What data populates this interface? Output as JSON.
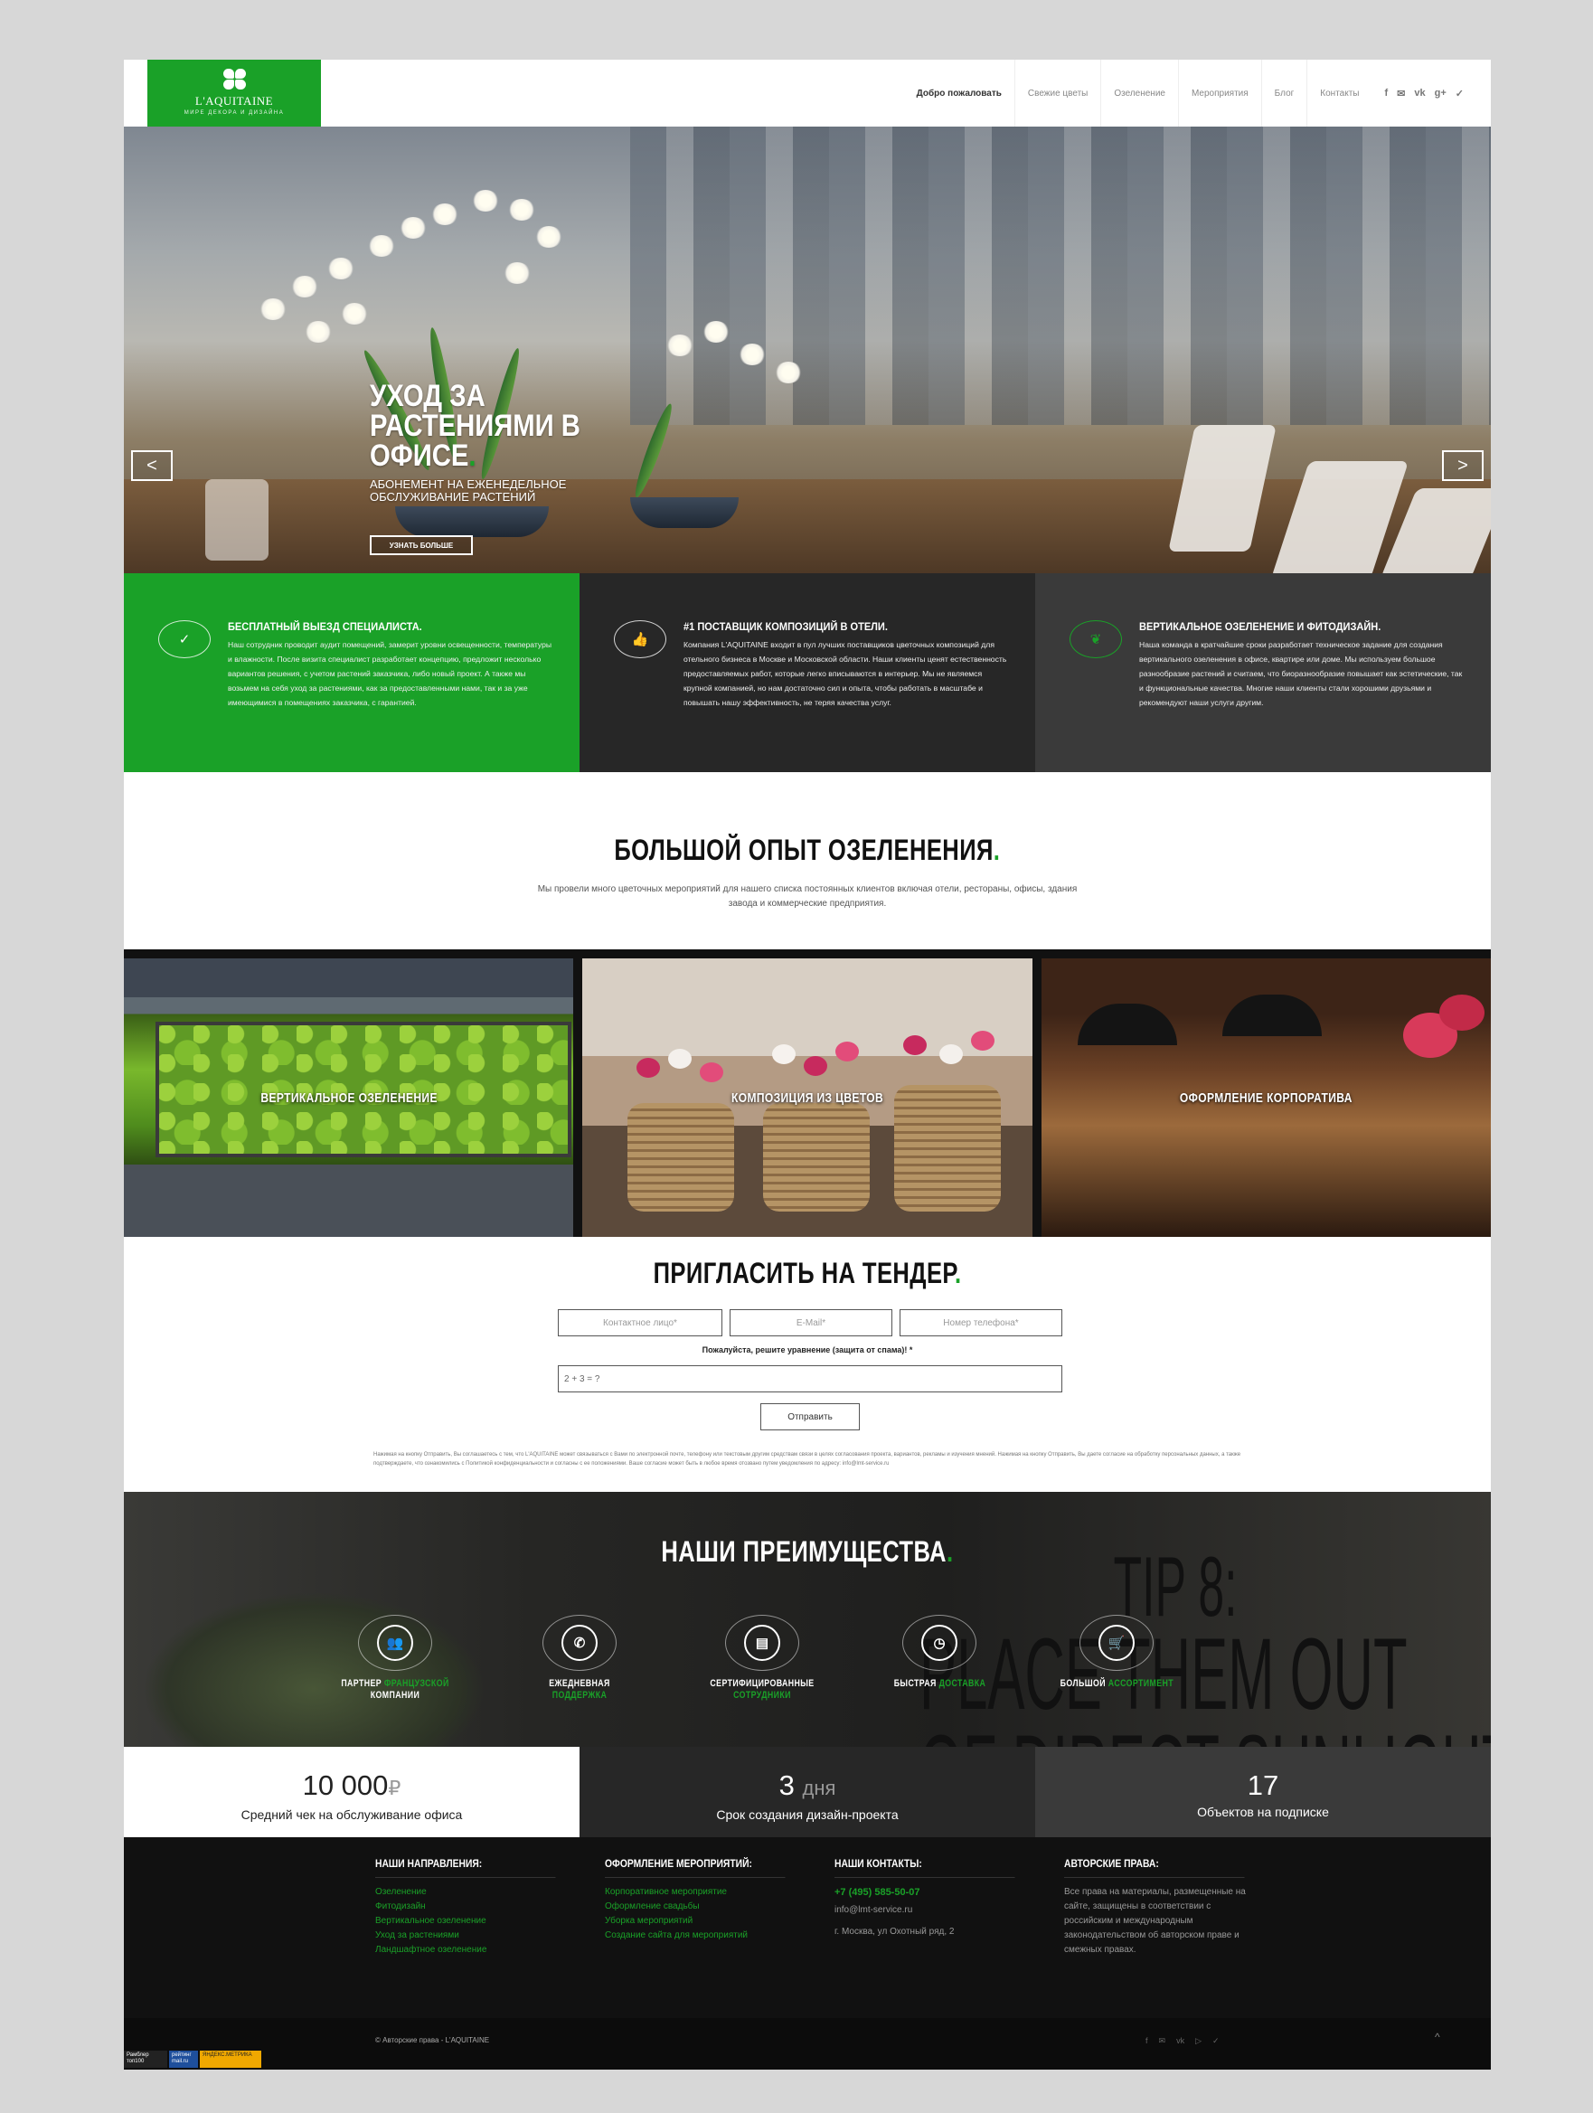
{
  "header": {
    "logo_name": "L'AQUITAINE",
    "logo_tagline": "МИРЕ ДЕКОРА И ДИЗАЙНА",
    "nav": [
      "Добро пожаловать",
      "Свежие цветы",
      "Озеленение",
      "Мероприятия",
      "Блог",
      "Контакты"
    ],
    "social": [
      "f",
      "✉",
      "vk",
      "g+",
      "✓"
    ]
  },
  "hero": {
    "title": "УХОД ЗА РАСТЕНИЯМИ В ОФИСЕ",
    "title_dot": ".",
    "subtitle": "АБОНЕМЕНТ НА ЕЖЕНЕДЕЛЬНОЕ ОБСЛУЖИВАНИЕ РАСТЕНИЙ",
    "button": "УЗНАТЬ БОЛЬШЕ",
    "prev": "<",
    "next": ">"
  },
  "features": [
    {
      "icon": "✓",
      "title": "БЕСПЛАТНЫЙ ВЫЕЗД СПЕЦИАЛИСТА.",
      "text": "Наш сотрудник проводит аудит помещений, замерит уровни освещенности, температуры и влажности. После визита специалист разработает концепцию, предложит несколько вариантов решения, с учетом растений заказчика, либо новый проект. А также мы возьмем на себя уход за растениями, как за предоставленными нами, так и за уже имеющимися в помещениях заказчика, с гарантией.",
      "bg": "#1aa128"
    },
    {
      "icon": "👍",
      "title": "#1 ПОСТАВЩИК КОМПОЗИЦИЙ В ОТЕЛИ.",
      "text": "Компания L'AQUITAINE входит в пул лучших поставщиков цветочных композиций для отельного бизнеса в Москве и Московской области. Наши клиенты ценят естественность предоставляемых работ, которые легко вписываются в интерьер. Мы не являемся крупной компанией, но нам достаточно сил и опыта, чтобы работать в масштабе и повышать нашу эффективность, не теряя качества услуг.",
      "bg": "#272727"
    },
    {
      "icon": "❦",
      "title": "ВЕРТИКАЛЬНОЕ ОЗЕЛЕНЕНИЕ И ФИТОДИЗАЙН.",
      "text": "Наша команда в кратчайшие сроки разработает техническое задание для создания вертикального озеленения в офисе, квартире или доме. Мы используем большое разнообразие растений и считаем, что биоразнообразие повышает как эстетические, так и функциональные качества. Многие наши клиенты стали хорошими друзьями и рекомендуют наши услуги другим.",
      "bg": "#3a3a3a"
    }
  ],
  "experience": {
    "title": "БОЛЬШОЙ ОПЫТ ОЗЕЛЕНЕНИЯ",
    "dot": ".",
    "text": "Мы провели много цветочных мероприятий для нашего списка постоянных клиентов включая отели, рестораны, офисы, здания завода и коммерческие предприятия."
  },
  "tiles": [
    "ВЕРТИКАЛЬНОЕ ОЗЕЛЕНЕНИЕ",
    "КОМПОЗИЦИЯ ИЗ ЦВЕТОВ",
    "ОФОРМЛЕНИЕ КОРПОРАТИВА"
  ],
  "tender": {
    "title": "ПРИГЛАСИТЬ НА ТЕНДЕР",
    "dot": ".",
    "contact_placeholder": "Контактное лицо*",
    "email_placeholder": "E-Mail*",
    "phone_placeholder": "Номер телефона*",
    "captcha_label": "Пожалуйста, решите уравнение (защита от спама)! *",
    "captcha_value": "2 + 3 = ?",
    "submit": "Отправить",
    "fine_print": "Нажимая на кнопку Отправить, Вы соглашаетесь с тем, что L'AQUITAINE может связываться с Вами по электронной почте, телефону или текстовым другим средствам связи в целях согласования проекта, вариантов, рекламы и изучения мнений. Нажимая на кнопку Отправить, Вы даете согласие на обработку персональных данных, а также подтверждаете, что ознакомились с Политикой конфиденциальности и согласны с ее положениями. Ваше согласие может быть в любое время отозвано путем уведомления по адресу: info@lmt-service.ru"
  },
  "advantages": {
    "title": "НАШИ ПРЕИМУЩЕСТВА",
    "dot": ".",
    "tip_lines": [
      "TIP 8:",
      "PLACE THEM OUT",
      "OF DIRECT SUNLIGHT"
    ],
    "items": [
      {
        "icon": "👥",
        "plain": "ПАРТНЕР ",
        "accent": "ФРАНЦУЗСКОЙ",
        "plain2": " КОМПАНИИ"
      },
      {
        "icon": "✆",
        "plain": "ЕЖЕДНЕВНАЯ ",
        "accent": "ПОДДЕРЖКА",
        "plain2": ""
      },
      {
        "icon": "▤",
        "plain": "СЕРТИФИЦИРОВАННЫЕ ",
        "accent": "СОТРУДНИКИ",
        "plain2": ""
      },
      {
        "icon": "◷",
        "plain": "БЫСТРАЯ ",
        "accent": "ДОСТАВКА",
        "plain2": ""
      },
      {
        "icon": "🛒",
        "plain": "БОЛЬШОЙ ",
        "accent": "АССОРТИМЕНТ",
        "plain2": ""
      }
    ]
  },
  "stats": [
    {
      "num": "10 000",
      "unit": "₽",
      "label": "Средний чек на обслуживание офиса",
      "bg": "#ffffff",
      "fg": "#222222"
    },
    {
      "num": "3",
      "unit": "дня",
      "label": "Срок создания дизайн-проекта",
      "bg": "#272727",
      "fg": "#ffffff"
    },
    {
      "num": "17",
      "unit": "",
      "label": "Объектов на подписке",
      "bg": "#3a3a3a",
      "fg": "#ffffff"
    }
  ],
  "footer": {
    "col1_title": "НАШИ НАПРАВЛЕНИЯ:",
    "col1": [
      "Озеленение",
      "Фитодизайн",
      "Вертикальное озеленение",
      "Уход за растениями",
      "Ландшафтное озеленение"
    ],
    "col2_title": "ОФОРМЛЕНИЕ МЕРОПРИЯТИЙ:",
    "col2": [
      "Корпоративное мероприятие",
      "Оформление свадьбы",
      "Уборка мероприятий",
      "Создание сайта для мероприятий"
    ],
    "col3_title": "НАШИ КОНТАКТЫ:",
    "phone": "+7 (495) 585-50-07",
    "email": "info@lmt-service.ru",
    "address": "г. Москва, ул Охотный ряд, 2",
    "col4_title": "АВТОРСКИЕ ПРАВА:",
    "copyright_text": "Все права на материалы, размещенные на сайте, защищены в соответствии с российским и международным законодательством об авторском праве и смежных правах.",
    "bottom_copy": "© Авторские права - L'AQUITAINE",
    "bottom_social": [
      "f",
      "✉",
      "vk",
      "▷",
      "✓"
    ],
    "up": "^"
  },
  "badges": [
    "Рамблер топ100",
    "рейтинг mail.ru",
    "ЯНДЕКС.МЕТРИКА"
  ],
  "colors": {
    "accent": "#1aa128",
    "dark": "#272727",
    "darker": "#111111"
  }
}
